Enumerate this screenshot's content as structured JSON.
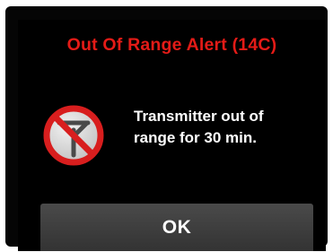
{
  "dialog": {
    "title": "Out Of Range Alert (14C)",
    "message_line1": "Transmitter out of",
    "message_line2": "range for 30 min.",
    "icon": "no-signal-antenna-icon",
    "ok_label": "OK"
  },
  "colors": {
    "title": "#e41b17",
    "background": "#000000",
    "button": "#3d3d3d",
    "icon_ring": "#d81e1e",
    "text": "#ffffff"
  }
}
